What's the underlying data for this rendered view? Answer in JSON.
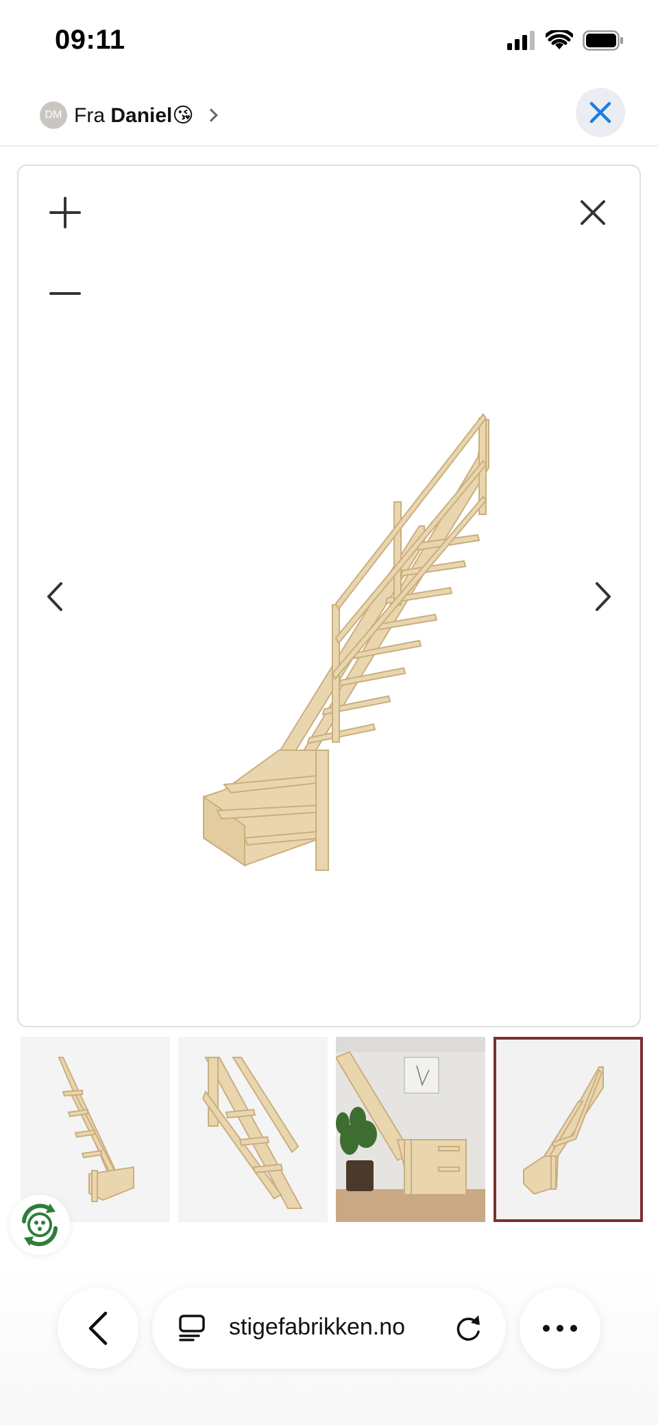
{
  "status_bar": {
    "time": "09:11",
    "icons": [
      "cellular-signal-icon",
      "wifi-icon",
      "battery-icon"
    ]
  },
  "header": {
    "avatar_initials": "DM",
    "from_label": "Fra",
    "sender_name": "Daniel",
    "sender_emoji": "😘",
    "close_icon": "close-icon"
  },
  "viewer": {
    "controls": [
      "zoom-in-icon",
      "zoom-out-icon",
      "close-icon",
      "chevron-left-icon",
      "chevron-right-icon"
    ],
    "image": "wooden-staircase-quarter-turn"
  },
  "thumbnails": [
    {
      "name": "staircase-front-view",
      "selected": false
    },
    {
      "name": "staircase-handrail-detail",
      "selected": false
    },
    {
      "name": "staircase-in-room",
      "selected": false
    },
    {
      "name": "staircase-side-view",
      "selected": true
    }
  ],
  "browser": {
    "url": "stigefabrikken.no",
    "icons": [
      "back-icon",
      "reader-icon",
      "reload-icon",
      "more-icon"
    ]
  },
  "colors": {
    "accent_blue": "#1a7fe0",
    "selected_border": "#7a2f32",
    "wood": "#ead6ae",
    "eco_green": "#2f7d3a"
  }
}
